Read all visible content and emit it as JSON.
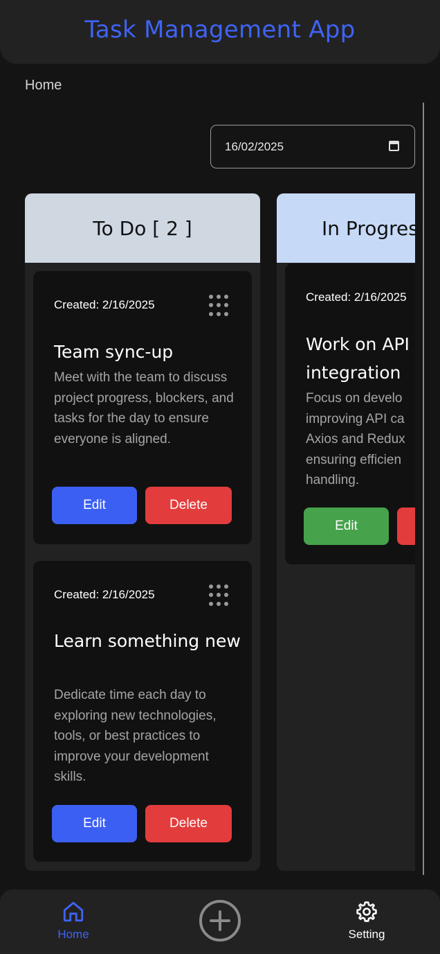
{
  "header": {
    "title": "Task Management App"
  },
  "breadcrumb": {
    "label": "Home"
  },
  "date_filter": {
    "value": "16/02/2025"
  },
  "columns": [
    {
      "title": "To Do [ 2 ]",
      "cards": [
        {
          "created": "Created: 2/16/2025",
          "title": "Team sync-up",
          "description": "Meet with the team to discuss project progress, blockers, and tasks for the day to ensure everyone is aligned.",
          "edit_label": "Edit",
          "delete_label": "Delete"
        },
        {
          "created": "Created: 2/16/2025",
          "title": "Learn something new",
          "description": "Dedicate time each day to exploring new technologies, tools, or best practices to improve your development skills.",
          "edit_label": "Edit",
          "delete_label": "Delete"
        }
      ]
    },
    {
      "title": "In Progres",
      "cards": [
        {
          "created": "Created: 2/16/2025",
          "title": "Work on API integration",
          "description_lines": [
            "Focus on develo",
            "improving API ca",
            "Axios and Redux",
            "ensuring efficien",
            "handling."
          ],
          "edit_label": "Edit"
        }
      ]
    }
  ],
  "bottom_nav": {
    "home_label": "Home",
    "add_icon": "plus-circle-icon",
    "setting_label": "Setting"
  },
  "colors": {
    "accent": "#3f63f5",
    "edit": "#3c5ff3",
    "delete": "#e33c3c",
    "edit_in_progress": "#46a24b",
    "todo_header": "#cfd7e1",
    "in_progress_header": "#c6daf8"
  }
}
